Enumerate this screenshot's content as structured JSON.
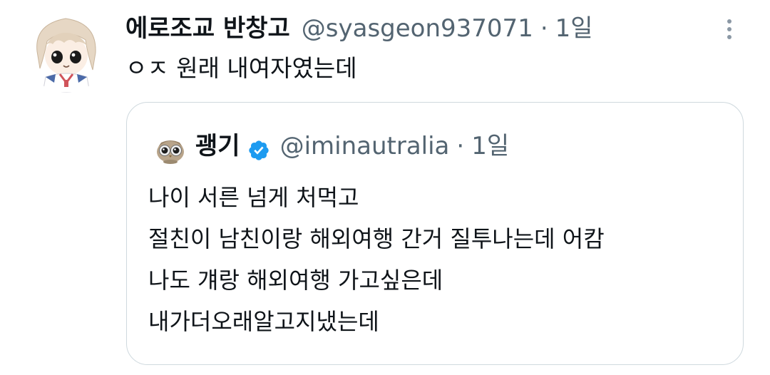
{
  "tweet": {
    "display_name": "에로조교 반창고",
    "handle": "@syasgeon937071",
    "separator": "·",
    "time": "1일",
    "text": "ㅇㅈ 원래 내여자였는데",
    "more_icon": "more-vertical-icon",
    "avatar_icon": "anime-avatar"
  },
  "quoted_tweet": {
    "display_name": "괭기",
    "verified_icon": "verified-badge-icon",
    "verified_color": "#1d9bf0",
    "handle": "@iminautralia",
    "separator": "·",
    "time": "1일",
    "avatar_icon": "owl-avatar",
    "lines": [
      "나이 서른 넘게 처먹고",
      "절친이 남친이랑 해외여행 간거 질투나는데 어캄",
      "나도 걔랑 해외여행 가고싶은데",
      "내가더오래알고지냈는데"
    ]
  },
  "colors": {
    "text_primary": "#0f1419",
    "text_secondary": "#536471",
    "border": "#cfd9de",
    "accent": "#1d9bf0"
  }
}
